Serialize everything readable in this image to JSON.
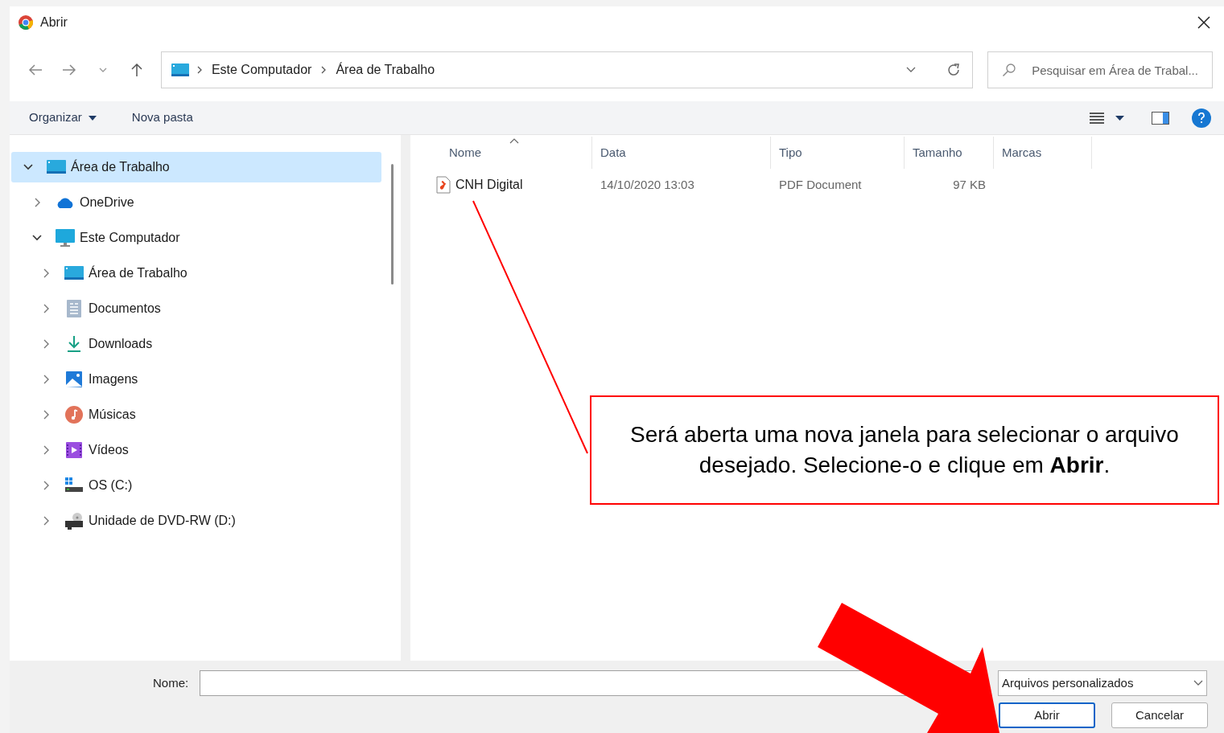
{
  "window": {
    "title": "Abrir"
  },
  "address": {
    "segments": [
      "Este Computador",
      "Área de Trabalho"
    ]
  },
  "search": {
    "placeholder": "Pesquisar em Área de Trabal..."
  },
  "toolbar": {
    "organize": "Organizar",
    "new_folder": "Nova pasta"
  },
  "tree": [
    {
      "label": "Área de Trabalho",
      "kind": "desktop",
      "expanded": true,
      "selected": true,
      "children": [
        {
          "label": "OneDrive",
          "kind": "cloud",
          "expanded": false,
          "selected": false
        },
        {
          "label": "Este Computador",
          "kind": "computer",
          "expanded": true,
          "selected": false,
          "children": [
            {
              "label": "Área de Trabalho",
              "kind": "desktop",
              "expanded": false,
              "selected": false
            },
            {
              "label": "Documentos",
              "kind": "documents",
              "expanded": false,
              "selected": false
            },
            {
              "label": "Downloads",
              "kind": "downloads",
              "expanded": false,
              "selected": false
            },
            {
              "label": "Imagens",
              "kind": "pictures",
              "expanded": false,
              "selected": false
            },
            {
              "label": "Músicas",
              "kind": "music",
              "expanded": false,
              "selected": false
            },
            {
              "label": "Vídeos",
              "kind": "videos",
              "expanded": false,
              "selected": false
            },
            {
              "label": "OS (C:)",
              "kind": "drive",
              "expanded": false,
              "selected": false
            },
            {
              "label": "Unidade de DVD-RW (D:)",
              "kind": "dvd",
              "expanded": false,
              "selected": false
            }
          ]
        }
      ]
    }
  ],
  "table": {
    "columns": [
      {
        "label": "Nome",
        "sorted": true
      },
      {
        "label": "Data",
        "sorted": false
      },
      {
        "label": "Tipo",
        "sorted": false
      },
      {
        "label": "Tamanho",
        "sorted": false
      },
      {
        "label": "Marcas",
        "sorted": false
      }
    ],
    "rows": [
      {
        "name": "CNH Digital",
        "date": "14/10/2020 13:03",
        "type": "PDF Document",
        "size": "97 KB",
        "selected": false
      }
    ]
  },
  "annotation": {
    "text": "Será aberta uma nova janela para selecionar o arquivo desejado. Selecione-o e clique em **Abrir**."
  },
  "footer": {
    "name_label": "Nome:",
    "filter": "Arquivos personalizados",
    "open": "Abrir",
    "cancel": "Cancelar"
  }
}
